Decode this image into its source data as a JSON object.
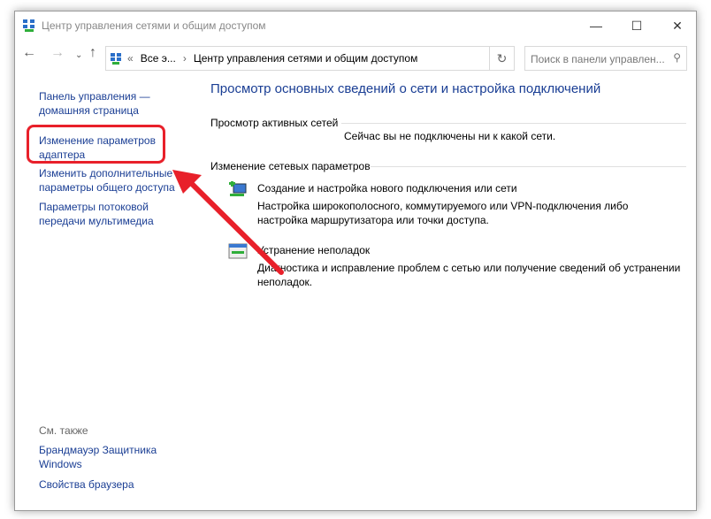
{
  "window": {
    "title": "Центр управления сетями и общим доступом"
  },
  "address": {
    "crumbs_prefix": "«",
    "crumb1": "Все э...",
    "sep": "›",
    "crumb2": "Центр управления сетями и общим доступом"
  },
  "search": {
    "placeholder": "Поиск в панели управлен..."
  },
  "sidebar": {
    "items": [
      "Панель управления — домашняя страница",
      "Изменение параметров адаптера",
      "Изменить дополнительные параметры общего доступа",
      "Параметры потоковой передачи мультимедиа"
    ],
    "see_also": "См. также",
    "also_items": [
      "Брандмауэр Защитника Windows",
      "Свойства браузера"
    ]
  },
  "main": {
    "heading": "Просмотр основных сведений о сети и настройка подключений",
    "active_label": "Просмотр активных сетей",
    "active_status": "Сейчас вы не подключены ни к какой сети.",
    "change_label": "Изменение сетевых параметров",
    "tasks": [
      {
        "title": "Создание и настройка нового подключения или сети",
        "desc": "Настройка широкополосного, коммутируемого или VPN-подключения либо настройка маршрутизатора или точки доступа."
      },
      {
        "title": "Устранение неполадок",
        "desc": "Диагностика и исправление проблем с сетью или получение сведений об устранении неполадок."
      }
    ]
  },
  "annotation_color": "#e8202a"
}
